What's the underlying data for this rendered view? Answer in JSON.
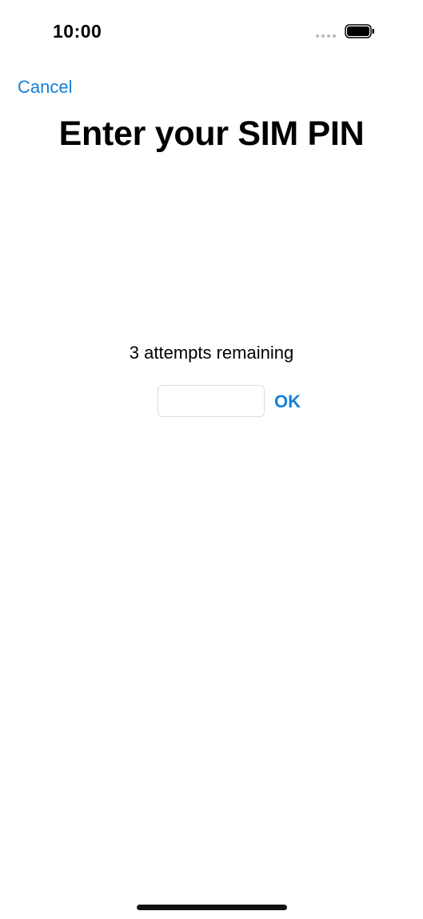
{
  "status_bar": {
    "time": "10:00",
    "signal_icon": "signal-dots-icon",
    "battery_icon": "battery-icon"
  },
  "navigation": {
    "cancel_label": "Cancel"
  },
  "title": "Enter your SIM PIN",
  "pin_entry": {
    "attempts_text": "3 attempts remaining",
    "input_value": "",
    "input_placeholder": "",
    "ok_label": "OK"
  },
  "colors": {
    "accent": "#1480d9",
    "background": "#ffffff",
    "text": "#000000"
  }
}
